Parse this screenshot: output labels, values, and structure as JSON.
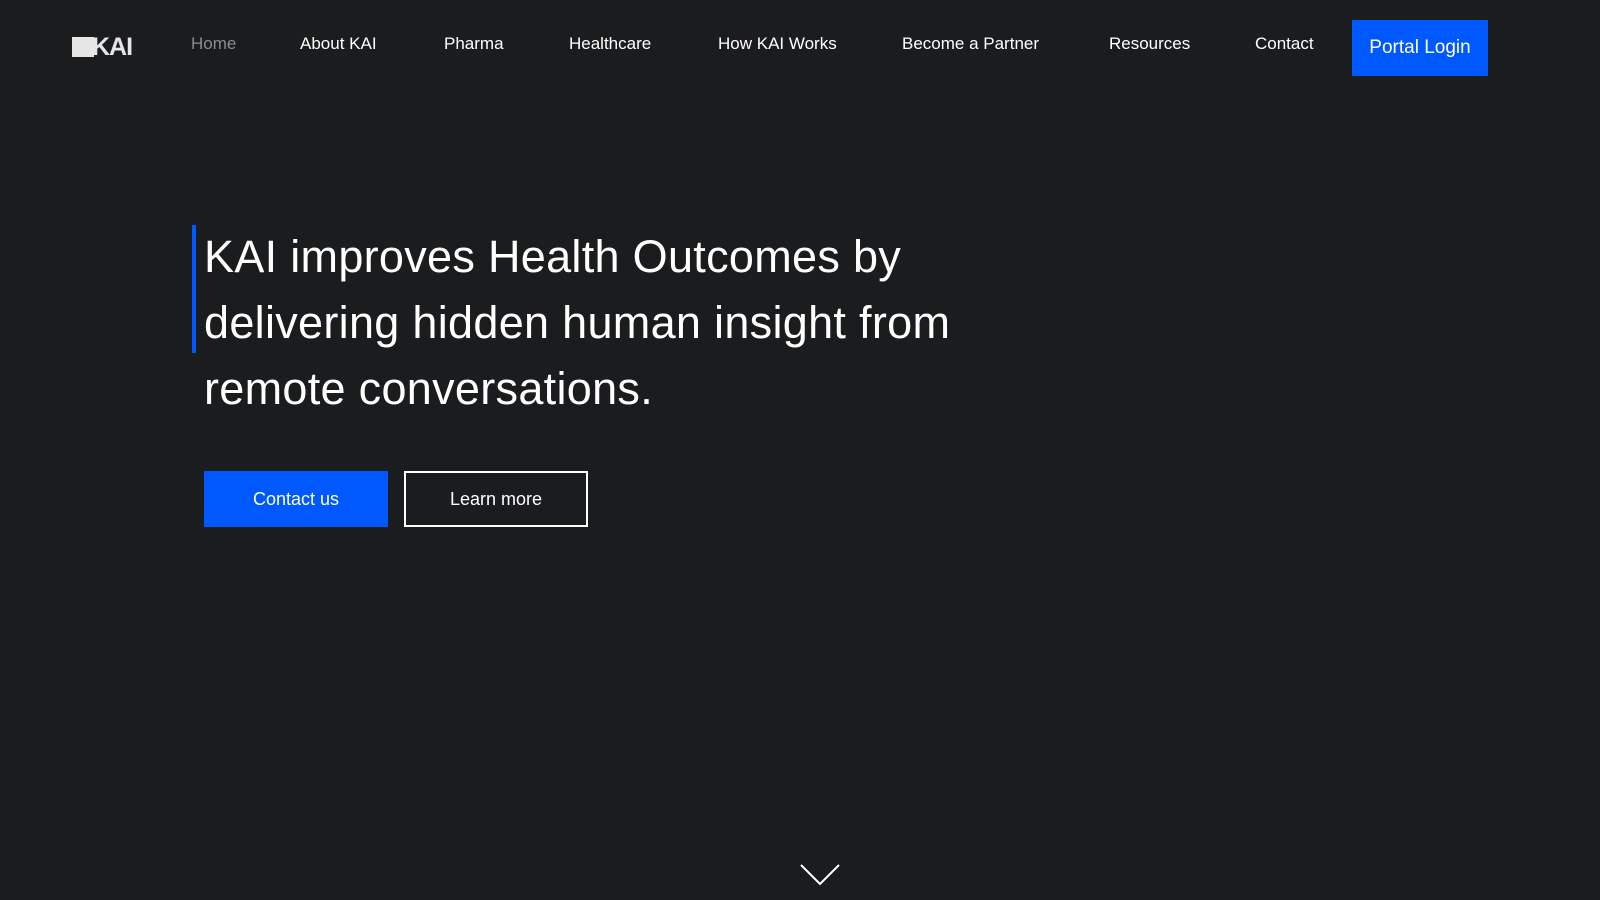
{
  "nav": {
    "logo_text": "KAI",
    "links": [
      {
        "label": "Home",
        "active": true
      },
      {
        "label": "About KAI"
      },
      {
        "label": "Pharma"
      },
      {
        "label": "Healthcare"
      },
      {
        "label": "How KAI Works"
      },
      {
        "label": "Become a Partner"
      },
      {
        "label": "Resources"
      },
      {
        "label": "Contact"
      }
    ],
    "portal_login": "Portal Login"
  },
  "hero": {
    "title": "KAI improves Health Outcomes by delivering hidden human insight from remote conversations.",
    "contact_button": "Contact us",
    "learn_button": "Learn more"
  },
  "icons": {
    "scroll_down": "chevron-down-icon"
  },
  "colors": {
    "background": "#1b1c1e",
    "accent": "#0058ff",
    "nav_active": "#8a8b8d"
  }
}
